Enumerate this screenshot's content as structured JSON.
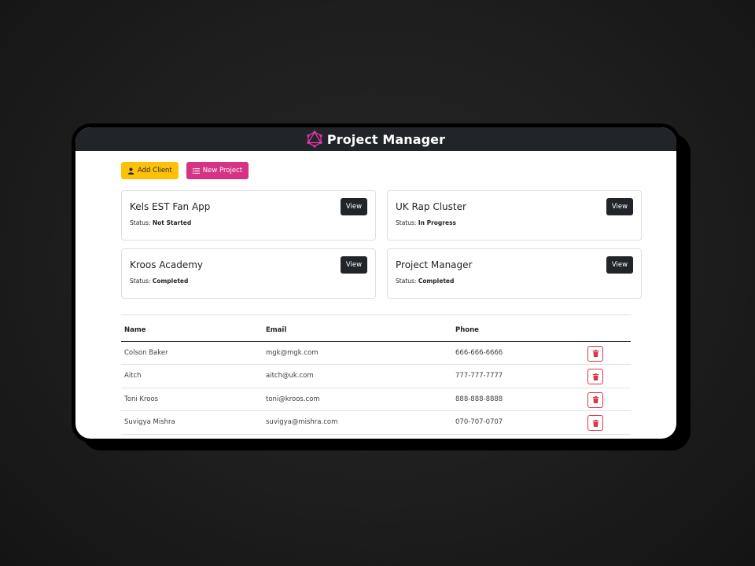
{
  "app": {
    "title": "Project Manager",
    "logo_icon": "graphql-logo-icon",
    "accent_color": "#e535ab"
  },
  "toolbar": {
    "add_client_label": "Add Client",
    "add_client_icon": "user-icon",
    "new_project_label": "New Project",
    "new_project_icon": "list-icon"
  },
  "projects": [
    {
      "name": "Kels EST Fan App",
      "status_label": "Status:",
      "status": "Not Started",
      "view_label": "View"
    },
    {
      "name": "UK Rap Cluster",
      "status_label": "Status:",
      "status": "In Progress",
      "view_label": "View"
    },
    {
      "name": "Kroos Academy",
      "status_label": "Status:",
      "status": "Completed",
      "view_label": "View"
    },
    {
      "name": "Project Manager",
      "status_label": "Status:",
      "status": "Completed",
      "view_label": "View"
    }
  ],
  "clients": {
    "columns": [
      "Name",
      "Email",
      "Phone"
    ],
    "rows": [
      {
        "name": "Colson Baker",
        "email": "mgk@mgk.com",
        "phone": "666-666-6666"
      },
      {
        "name": "Aitch",
        "email": "aitch@uk.com",
        "phone": "777-777-7777"
      },
      {
        "name": "Toni Kroos",
        "email": "toni@kroos.com",
        "phone": "888-888-8888"
      },
      {
        "name": "Suvigya Mishra",
        "email": "suvigya@mishra.com",
        "phone": "070-707-0707"
      }
    ],
    "delete_icon": "trash-icon"
  }
}
